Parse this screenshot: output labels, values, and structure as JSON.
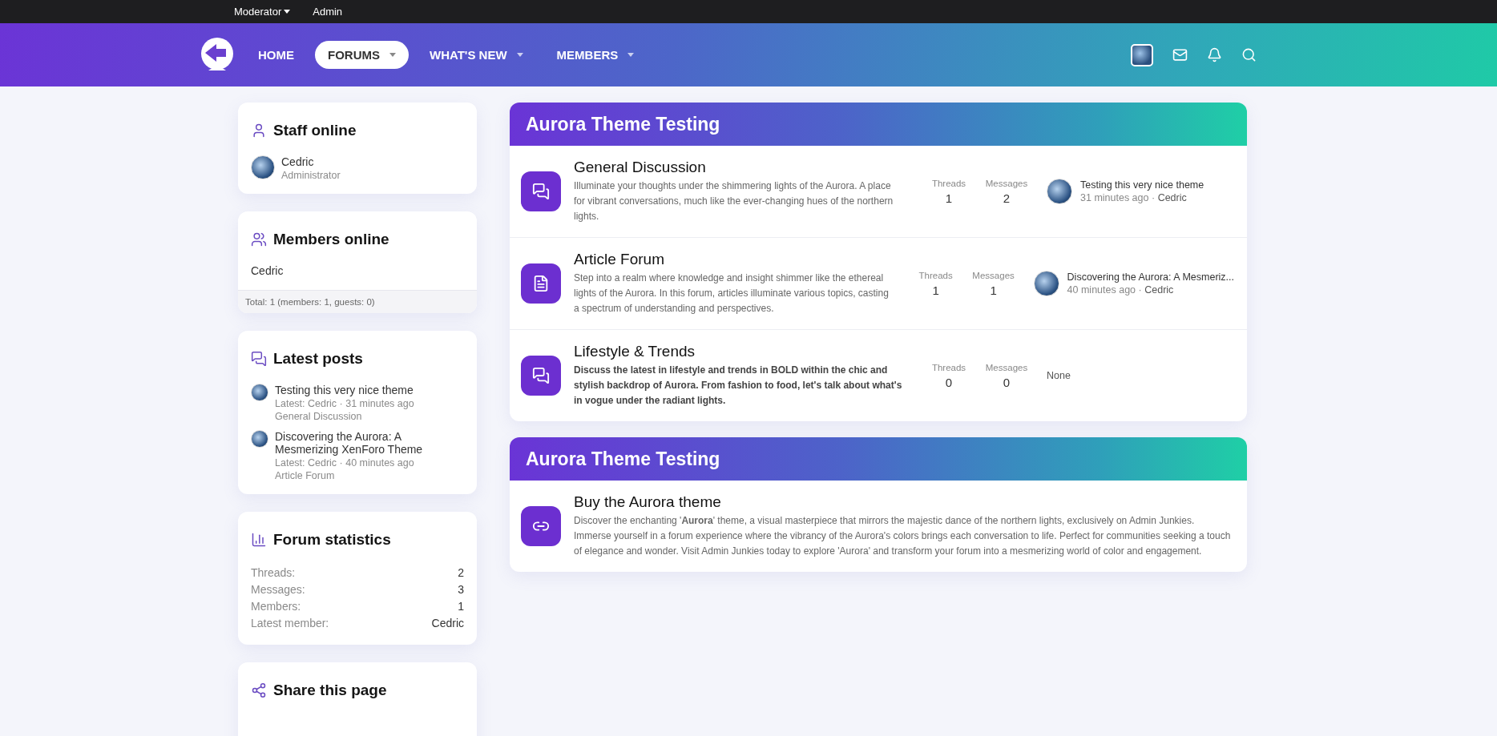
{
  "top_bar": {
    "items": [
      {
        "label": "Moderator",
        "has_menu": true
      },
      {
        "label": "Admin",
        "has_menu": false
      }
    ]
  },
  "nav": {
    "items": [
      {
        "label": "HOME",
        "selected": false,
        "has_menu": false
      },
      {
        "label": "FORUMS",
        "selected": true,
        "has_menu": true
      },
      {
        "label": "WHAT'S NEW",
        "selected": false,
        "has_menu": true
      },
      {
        "label": "MEMBERS",
        "selected": false,
        "has_menu": true
      }
    ]
  },
  "sidebar": {
    "widgets": [
      {
        "kind": "staff",
        "title": "Staff online",
        "members": [
          {
            "name": "Cedric",
            "role": "Administrator"
          }
        ]
      },
      {
        "kind": "members",
        "title": "Members online",
        "names": [
          "Cedric"
        ],
        "footer": "Total: 1 (members: 1, guests: 0)"
      },
      {
        "kind": "posts",
        "title": "Latest posts",
        "posts": [
          {
            "title": "Testing this very nice theme",
            "meta": "Latest: Cedric · 31 minutes ago",
            "forum": "General Discussion"
          },
          {
            "title": "Discovering the Aurora: A Mesmerizing XenForo Theme",
            "meta": "Latest: Cedric · 40 minutes ago",
            "forum": "Article Forum"
          }
        ]
      },
      {
        "kind": "stats",
        "title": "Forum statistics",
        "rows": [
          {
            "label": "Threads:",
            "value": "2"
          },
          {
            "label": "Messages:",
            "value": "3"
          },
          {
            "label": "Members:",
            "value": "1"
          },
          {
            "label": "Latest member:",
            "value": "Cedric"
          }
        ]
      },
      {
        "kind": "share",
        "title": "Share this page"
      }
    ]
  },
  "sections": [
    {
      "title": "Aurora Theme Testing",
      "nodes": [
        {
          "kind": "discussion",
          "title": "General Discussion",
          "description": "Illuminate your thoughts under the shimmering lights of the Aurora. A place for vibrant conversations, much like the ever-changing hues of the northern lights.",
          "description_bold": false,
          "threads_label": "Threads",
          "threads": "1",
          "messages_label": "Messages",
          "messages": "2",
          "last_post": {
            "kind": "post",
            "title": "Testing this very nice theme",
            "time": "31 minutes ago",
            "separator": "·",
            "author": "Cedric"
          }
        },
        {
          "kind": "article",
          "title": "Article Forum",
          "description": "Step into a realm where knowledge and insight shimmer like the ethereal lights of the Aurora. In this forum, articles illuminate various topics, casting a spectrum of understanding and perspectives.",
          "description_bold": false,
          "threads_label": "Threads",
          "threads": "1",
          "messages_label": "Messages",
          "messages": "1",
          "last_post": {
            "kind": "post",
            "title": "Discovering the Aurora: A Mesmeriz...",
            "time": "40 minutes ago",
            "separator": "·",
            "author": "Cedric"
          }
        },
        {
          "kind": "discussion",
          "title": "Lifestyle & Trends",
          "description": "Discuss the latest in lifestyle and trends in BOLD within the chic and stylish backdrop of Aurora. From fashion to food, let's talk about what's in vogue under the radiant lights.",
          "description_bold": true,
          "threads_label": "Threads",
          "threads": "0",
          "messages_label": "Messages",
          "messages": "0",
          "last_post": {
            "kind": "none",
            "text": "None"
          }
        }
      ]
    },
    {
      "title": "Aurora Theme Testing",
      "nodes": [
        {
          "kind": "link",
          "title": "Buy the Aurora theme",
          "description": "Discover the enchanting '**Aurora**' theme, a visual masterpiece that mirrors the majestic dance of the northern lights, exclusively on Admin Junkies. Immerse yourself in a forum experience where the vibrancy of the Aurora's colors brings each conversation to life. Perfect for communities seeking a touch of elegance and wonder. Visit Admin Junkies today to explore 'Aurora' and transform your forum into a mesmerizing world of color and engagement.",
          "description_bold": false
        }
      ]
    }
  ]
}
